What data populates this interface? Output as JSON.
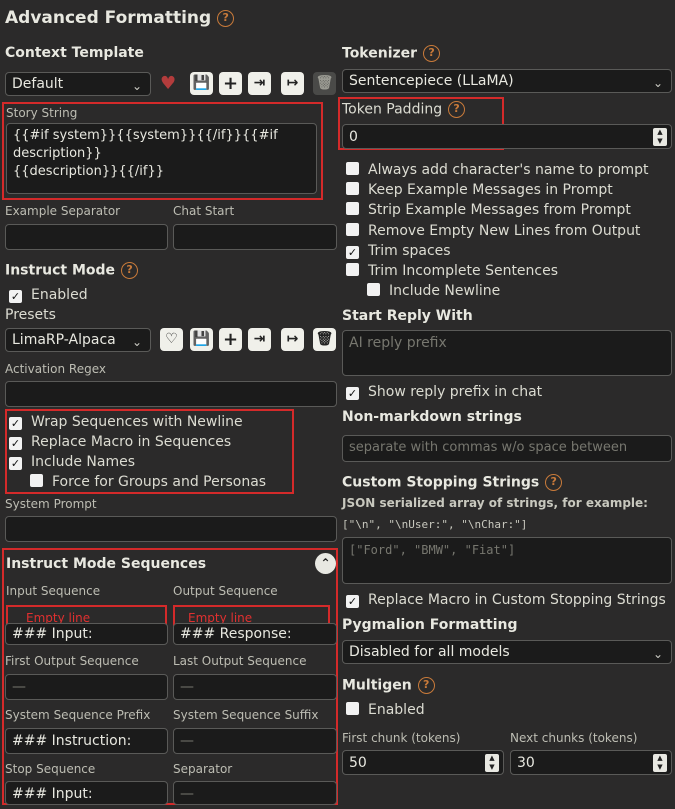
{
  "title": "Advanced Formatting",
  "help_glyph": "?",
  "context": {
    "heading": "Context Template",
    "selected": "Default",
    "story_label": "Story String",
    "story_value": "{{#if system}}{{system}}{{/if}}{{#if description}}\n{{description}}{{/if}}",
    "example_sep_label": "Example Separator",
    "chat_start_label": "Chat Start"
  },
  "instruct": {
    "heading": "Instruct Mode",
    "enabled_label": "Enabled",
    "presets_label": "Presets",
    "preset_selected": "LimaRP-Alpaca",
    "activation_label": "Activation Regex",
    "wrap_label": "Wrap Sequences with Newline",
    "replace_label": "Replace Macro in Sequences",
    "include_names_label": "Include Names",
    "force_label": "Force for Groups and Personas",
    "system_prompt_label": "System Prompt"
  },
  "sequences": {
    "heading": "Instruct Mode Sequences",
    "input_label": "Input Sequence",
    "output_label": "Output Sequence",
    "empty_line": "Empty line",
    "input_value": "### Input:",
    "output_value": "### Response:",
    "first_output_label": "First Output Sequence",
    "last_output_label": "Last Output Sequence",
    "dash": "—",
    "sys_prefix_label": "System Sequence Prefix",
    "sys_suffix_label": "System Sequence Suffix",
    "sys_prefix_value": "### Instruction:",
    "stop_label": "Stop Sequence",
    "separator_label": "Separator",
    "stop_value": "### Input:"
  },
  "tokenizer": {
    "heading": "Tokenizer",
    "selected": "Sentencepiece (LLaMA)",
    "padding_label": "Token Padding",
    "padding_value": "0"
  },
  "options": {
    "always_name": "Always add character's name to prompt",
    "keep_examples": "Keep Example Messages in Prompt",
    "strip_examples": "Strip Example Messages from Prompt",
    "remove_empty": "Remove Empty New Lines from Output",
    "trim_spaces": "Trim spaces",
    "trim_incomplete": "Trim Incomplete Sentences",
    "include_newline": "Include Newline"
  },
  "reply": {
    "heading": "Start Reply With",
    "placeholder": "AI reply prefix",
    "show_prefix": "Show reply prefix in chat"
  },
  "nonmd": {
    "heading": "Non-markdown strings",
    "placeholder": "separate with commas w/o space between"
  },
  "stopping": {
    "heading": "Custom Stopping Strings",
    "desc": "JSON serialized array of strings, for example:",
    "example": "[\"\\n\", \"\\nUser:\", \"\\nChar:\"]",
    "placeholder": "[\"Ford\", \"BMW\", \"Fiat\"]",
    "replace_macro": "Replace Macro in Custom Stopping Strings"
  },
  "pygmalion": {
    "heading": "Pygmalion Formatting",
    "selected": "Disabled for all models"
  },
  "multigen": {
    "heading": "Multigen",
    "enabled_label": "Enabled",
    "first_label": "First chunk (tokens)",
    "next_label": "Next chunks (tokens)",
    "first_value": "50",
    "next_value": "30"
  }
}
